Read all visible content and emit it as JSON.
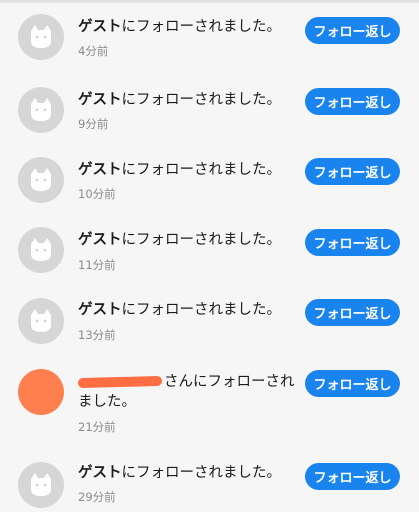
{
  "colors": {
    "button": "#1a84ee",
    "avatar_placeholder": "#d6d6d6",
    "user_avatar": "#ff7f4f"
  },
  "items": [
    {
      "name": "ゲスト",
      "rest": "にフォローされました。",
      "time": "4分前",
      "button": "フォロー返し",
      "avatar": "cat-placeholder-icon"
    },
    {
      "name": "ゲスト",
      "rest": "にフォローされました。",
      "time": "9分前",
      "button": "フォロー返し",
      "avatar": "cat-placeholder-icon"
    },
    {
      "name": "ゲスト",
      "rest": "にフォローされました。",
      "time": "10分前",
      "button": "フォロー返し",
      "avatar": "cat-placeholder-icon"
    },
    {
      "name": "ゲスト",
      "rest": "にフォローされました。",
      "time": "11分前",
      "button": "フォロー返し",
      "avatar": "cat-placeholder-icon"
    },
    {
      "name": "ゲスト",
      "rest": "にフォローされました。",
      "time": "13分前",
      "button": "フォロー返し",
      "avatar": "cat-placeholder-icon"
    },
    {
      "rest": "さんにフォローされました。",
      "time": "21分前",
      "button": "フォロー返し",
      "avatar": "user-avatar"
    },
    {
      "name": "ゲスト",
      "rest": "にフォローされました。",
      "time": "29分前",
      "button": "フォロー返し",
      "avatar": "cat-placeholder-icon"
    }
  ]
}
